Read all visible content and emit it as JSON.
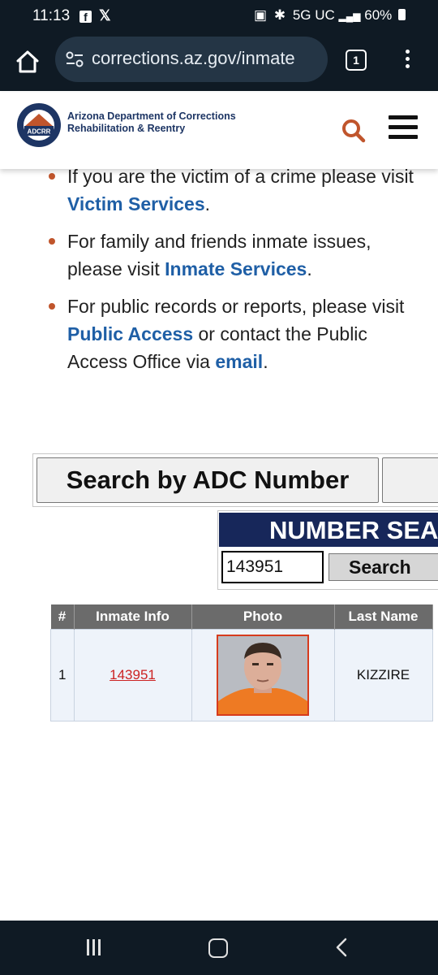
{
  "status_bar": {
    "time": "11:13",
    "network": "5G UC",
    "battery": "60%"
  },
  "browser": {
    "url": "corrections.az.gov/inmate",
    "tab_count": "1"
  },
  "site_header": {
    "agency_line1": "Arizona Department of Corrections",
    "agency_line2": "Rehabilitation & Reentry",
    "logo_text": "ADCRR"
  },
  "bullets": [
    {
      "prefix": "If you are the victim of a crime please visit ",
      "link": "Victim Services",
      "middle": "",
      "link2": "",
      "suffix": "."
    },
    {
      "prefix": "For family and friends inmate issues, please visit ",
      "link": "Inmate Services",
      "middle": "",
      "link2": "",
      "suffix": "."
    },
    {
      "prefix": "For public records or reports, please visit ",
      "link": "Public Access",
      "middle": " or contact the Public Access Office via ",
      "link2": "email",
      "suffix": "."
    }
  ],
  "search": {
    "tab_adc": "Search by ADC Number",
    "panel_title": "NUMBER SEARCH",
    "input_value": "143951",
    "search_button": "Search"
  },
  "results": {
    "headers": [
      "#",
      "Inmate Info",
      "Photo",
      "Last Name"
    ],
    "rows": [
      {
        "num": "1",
        "inmate_id": "143951",
        "last_name": "KIZZIRE"
      }
    ]
  },
  "colors": {
    "bar_bg": "#0f1a24",
    "navy": "#17275a",
    "link_blue": "#1f5fa6",
    "accent_orange": "#c0552c",
    "result_link": "#cc2222"
  }
}
